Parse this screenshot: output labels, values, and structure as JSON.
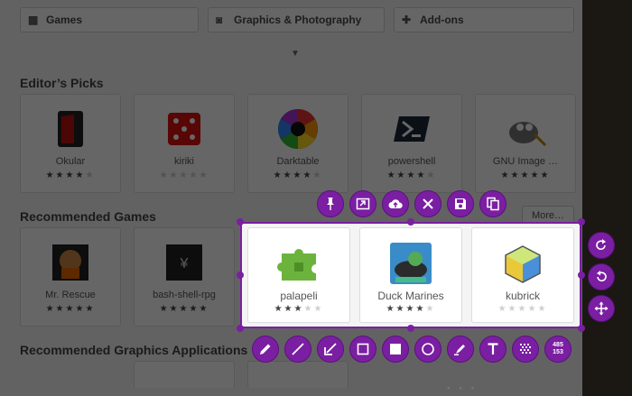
{
  "categories": [
    {
      "label": "Games",
      "icon": "gamepad-icon"
    },
    {
      "label": "Graphics & Photography",
      "icon": "camera-icon"
    },
    {
      "label": "Add-ons",
      "icon": "puzzle-icon"
    }
  ],
  "sections": {
    "editors_picks": "Editor’s Picks",
    "recommended_games": "Recommended Games",
    "recommended_graphics": "Recommended Graphics Applications",
    "more_button": "More…"
  },
  "editors_picks": [
    {
      "name": "Okular",
      "rating": 4
    },
    {
      "name": "kiriki",
      "rating": 0
    },
    {
      "name": "Darktable",
      "rating": 4
    },
    {
      "name": "powershell",
      "rating": 4
    },
    {
      "name": "GNU Image …",
      "rating": 5
    }
  ],
  "recommended_games": [
    {
      "name": "Mr. Rescue",
      "rating": 5
    },
    {
      "name": "bash-shell-rpg",
      "rating": 5
    }
  ],
  "selected_apps": [
    {
      "name": "palapeli",
      "rating": 3
    },
    {
      "name": "Duck Marines",
      "rating": 4
    },
    {
      "name": "kubrick",
      "rating": 0
    }
  ],
  "toolbar_top": [
    {
      "name": "pin-icon",
      "tooltip": ""
    },
    {
      "name": "open-with-icon",
      "tooltip": ""
    },
    {
      "name": "upload-cloud-icon",
      "tooltip": ""
    },
    {
      "name": "close-icon",
      "tooltip": ""
    },
    {
      "name": "save-icon",
      "tooltip": ""
    },
    {
      "name": "copy-icon",
      "tooltip": ""
    }
  ],
  "toolbar_bottom": [
    {
      "name": "pencil-icon"
    },
    {
      "name": "line-icon"
    },
    {
      "name": "arrow-icon"
    },
    {
      "name": "rectangle-icon"
    },
    {
      "name": "filled-rectangle-icon"
    },
    {
      "name": "circle-icon"
    },
    {
      "name": "marker-icon"
    },
    {
      "name": "text-icon"
    },
    {
      "name": "pixelate-icon"
    }
  ],
  "coordinates": {
    "width": "485",
    "height": "153"
  },
  "side_tools": [
    {
      "name": "redo-icon"
    },
    {
      "name": "undo-icon"
    },
    {
      "name": "move-icon"
    }
  ],
  "colors": {
    "accent": "#7a1fa2"
  }
}
